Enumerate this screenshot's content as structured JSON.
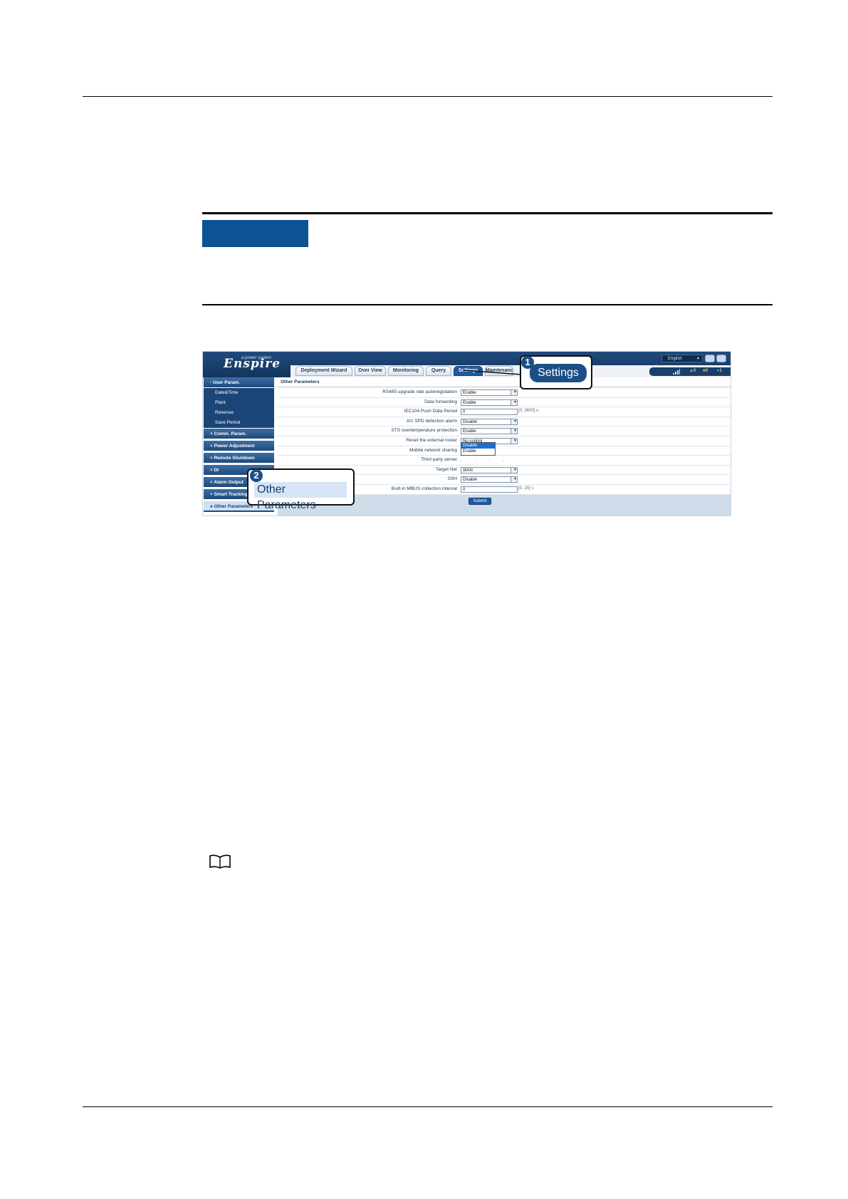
{
  "app": {
    "logo": "Enspire",
    "logo_sub": "a power system",
    "language": "English",
    "tabs": [
      {
        "label": "Deployment Wizard"
      },
      {
        "label": "Over View"
      },
      {
        "label": "Monitoring"
      },
      {
        "label": "Query"
      },
      {
        "label": "Settings"
      },
      {
        "label": "Maintenance"
      }
    ],
    "alarms": {
      "major": "0",
      "minor": "0",
      "warning": "1"
    }
  },
  "sidebar": {
    "user_param": "User Param.",
    "sub_items": [
      {
        "label": "Date&Time"
      },
      {
        "label": "Plant"
      },
      {
        "label": "Revenue"
      },
      {
        "label": "Save Period"
      }
    ],
    "sections": [
      {
        "label": "Comm. Param."
      },
      {
        "label": "Power Adjustment"
      },
      {
        "label": "Remote Shutdown"
      },
      {
        "label": "DI"
      },
      {
        "label": "Alarm Output"
      },
      {
        "label": "Smart Tracking"
      },
      {
        "label": "Other Parameters"
      }
    ]
  },
  "content": {
    "title": "Other Parameters",
    "rows": [
      {
        "label": "RS485 upgrade rate autonegotiation",
        "value": "Enable",
        "unit": ""
      },
      {
        "label": "Data forwarding",
        "value": "Enable",
        "unit": ""
      },
      {
        "label": "IEC104 Push Data Period",
        "value": "0",
        "unit": "[0, 3600] s"
      },
      {
        "label": "AI1 SPD detection alarm",
        "value": "Disable",
        "unit": ""
      },
      {
        "label": "STS overtemperature protection",
        "value": "Enable",
        "unit": ""
      },
      {
        "label": "Reset the external router",
        "value": "No control",
        "unit": ""
      },
      {
        "label": "Mobile network sharing",
        "value": "Disable",
        "unit": ""
      },
      {
        "label": "Third party server",
        "value": "",
        "unit": ""
      },
      {
        "label": "Target Net",
        "value": "WAN",
        "unit": ""
      },
      {
        "label": "SSH",
        "value": "Disable",
        "unit": ""
      },
      {
        "label": "Built-in MBUS collection interval",
        "value": "0",
        "unit": "[0, 15] s"
      }
    ],
    "dropdown_options": [
      "Disable",
      "Enable"
    ],
    "submit_label": "Submit"
  },
  "callouts": {
    "one_num": "1",
    "one_label": "Settings",
    "two_num": "2",
    "two_label": "Other Parameters"
  },
  "colors": {
    "notice_tab": "#0b5394",
    "header": "#1f4a7c",
    "callout": "#1b4f86"
  }
}
